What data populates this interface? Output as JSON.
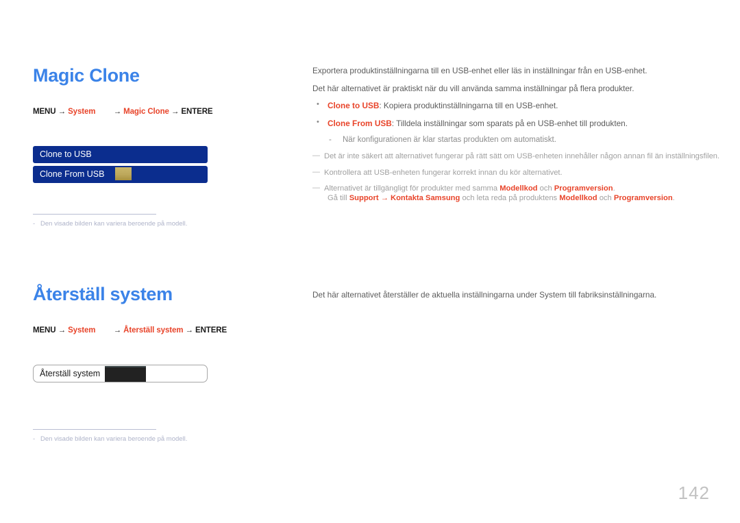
{
  "document": {
    "page_number": "142",
    "colors": {
      "heading_blue": "#3b83e8",
      "accent_red": "#e8442a",
      "osd_blue": "#0b2d8e",
      "osd_gold": "#bda85c",
      "footnote_gray": "#aeb3c9",
      "body_gray": "#5b5b5b"
    }
  },
  "sections": [
    {
      "heading": "Magic Clone",
      "menu_path": {
        "menu_label": "MENU",
        "arrow1": "→",
        "system_label": "System",
        "arrow2": "→",
        "item_label": "Magic Clone",
        "arrow3": "→",
        "enter_label": "ENTERE"
      },
      "osd": {
        "type": "blue",
        "rows": [
          {
            "label": "Clone to USB",
            "swatch": false
          },
          {
            "label": "Clone From USB",
            "swatch": true
          }
        ]
      },
      "footnote": {
        "dash": "-",
        "text": "Den visade bilden kan variera beroende på modell."
      },
      "body": {
        "intro": [
          "Exportera produktinställningarna till en USB-enhet eller läs in inställningar från en USB-enhet.",
          "Det här alternativet är praktiskt när du vill använda samma inställningar på flera produkter."
        ],
        "bullets": [
          {
            "marker": "•",
            "term": "Clone to USB",
            "rest": ": Kopiera produktinställningarna till en USB-enhet."
          },
          {
            "marker": "•",
            "term": "Clone From USB",
            "rest": ": Tilldela inställningar som sparats på en USB-enhet till produkten."
          }
        ],
        "sub_dash": {
          "marker": "-",
          "text": "När konfigurationen är klar startas produkten om automatiskt."
        },
        "notes": [
          {
            "marker": "—",
            "text": "Det är inte säkert att alternativet fungerar på rätt sätt om USB-enheten innehåller någon annan fil än inställningsfilen."
          },
          {
            "marker": "—",
            "text": "Kontrollera att USB-enheten fungerar korrekt innan du kör alternativet."
          }
        ],
        "note_rich": {
          "marker": "—",
          "line1_pre": "Alternativet är tillgängligt för produkter med samma ",
          "line1_term1": "Modellkod",
          "line1_mid": " och ",
          "line1_term2": "Programversion",
          "line1_post": ".",
          "line2_pre": "Gå till ",
          "line2_term1": "Support",
          "line2_arrow": " → ",
          "line2_term2": "Kontakta Samsung",
          "line2_mid": " och leta reda på produktens ",
          "line2_term3": "Modellkod",
          "line2_mid2": " och ",
          "line2_term4": "Programversion",
          "line2_post": "."
        }
      }
    },
    {
      "heading": "Återställ system",
      "menu_path": {
        "menu_label": "MENU",
        "arrow1": "→",
        "system_label": "System",
        "arrow2": "→",
        "item_label": "Återställ system",
        "arrow3": "→",
        "enter_label": "ENTERE"
      },
      "osd": {
        "type": "white",
        "label": "Återställ system"
      },
      "footnote": {
        "dash": "-",
        "text": "Den visade bilden kan variera beroende på modell."
      },
      "body": {
        "intro": [
          "Det här alternativet återställer de aktuella inställningarna under System till fabriksinställningarna."
        ]
      }
    }
  ]
}
